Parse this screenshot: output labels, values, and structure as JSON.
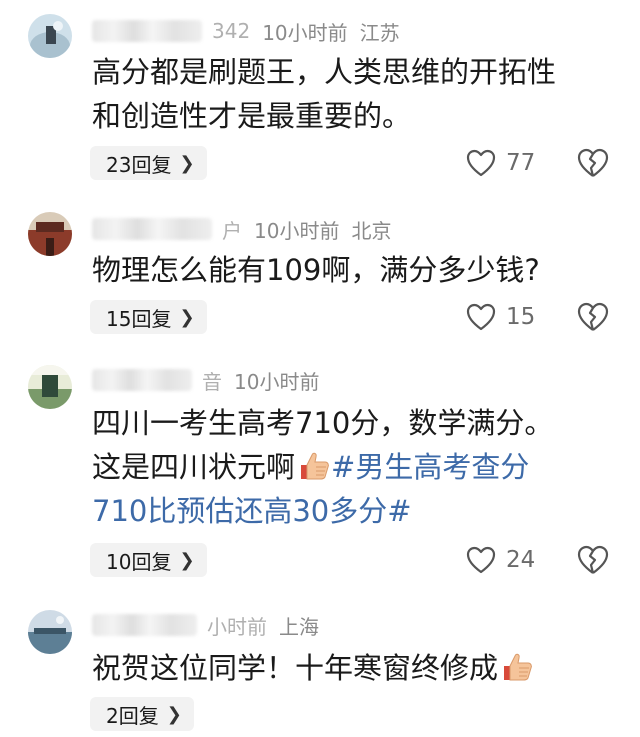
{
  "comments": [
    {
      "name_tail": "342",
      "time": "10小时前",
      "location": "江苏",
      "lines": [
        "高分都是刷题王，人类思维的开拓性",
        "和创造性才是最重要的。"
      ],
      "reply_label": "23回复",
      "likes": "77"
    },
    {
      "name_tail": "户",
      "time": "10小时前",
      "location": "北京",
      "lines": [
        "物理怎么能有109啊，满分多少钱?"
      ],
      "reply_label": "15回复",
      "likes": "15"
    },
    {
      "name_tail": "音",
      "time": "10小时前",
      "location": "",
      "line1": "四川一考生高考710分，数学满分。",
      "line2_text": "这是四川状元啊",
      "hashtag_part1": "#男生高考查分",
      "hashtag_part2": "710比预估还高30多分#",
      "reply_label": "10回复",
      "likes": "24"
    },
    {
      "name_tail": "小时前",
      "time": "",
      "location": "上海",
      "text": "祝贺这位同学！十年寒窗终修成",
      "reply_label": "2回复"
    }
  ],
  "icons": {
    "like": "heart-outline-icon",
    "dislike": "broken-heart-icon",
    "emoji": "thumbs-up-emoji-icon"
  },
  "colors": {
    "hashtag": "#3d6aa8",
    "meta": "#8a8a8a",
    "button_bg": "#f2f2f2"
  }
}
